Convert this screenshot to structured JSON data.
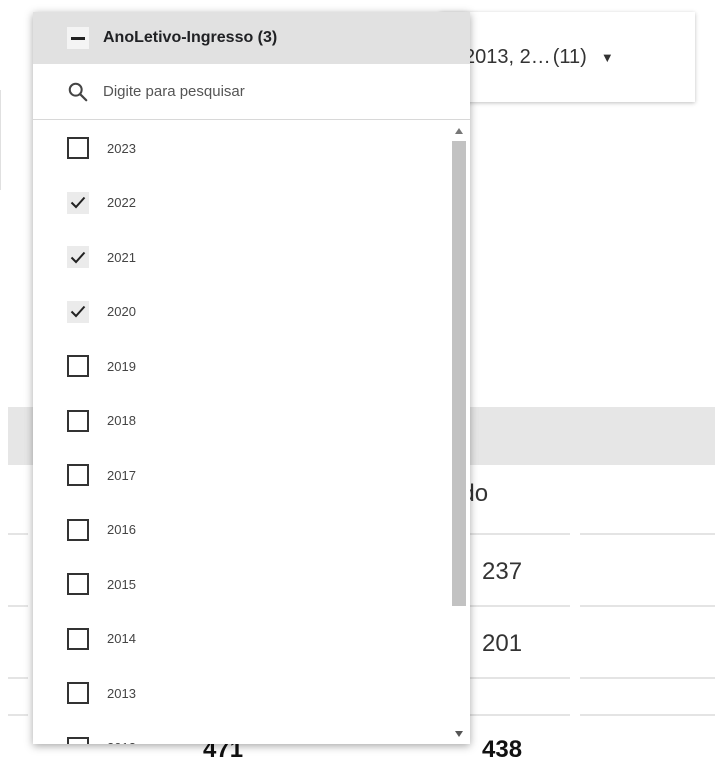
{
  "background": {
    "filter_value": "2013, 2…",
    "filter_count": "(11)",
    "text_fragment": "vo",
    "column_header": "ardo",
    "row_values": [
      "237",
      "201"
    ],
    "totals": [
      "471",
      "438"
    ]
  },
  "dropdown": {
    "title": "AnoLetivo-Ingresso (3)",
    "search_placeholder": "Digite para pesquisar",
    "items": [
      {
        "label": "2023",
        "checked": false
      },
      {
        "label": "2022",
        "checked": true
      },
      {
        "label": "2021",
        "checked": true
      },
      {
        "label": "2020",
        "checked": true
      },
      {
        "label": "2019",
        "checked": false
      },
      {
        "label": "2018",
        "checked": false
      },
      {
        "label": "2017",
        "checked": false
      },
      {
        "label": "2016",
        "checked": false
      },
      {
        "label": "2015",
        "checked": false
      },
      {
        "label": "2014",
        "checked": false
      },
      {
        "label": "2013",
        "checked": false
      },
      {
        "label": "2012",
        "checked": false
      }
    ]
  },
  "icons": {
    "header": "deselect-all-icon",
    "search": "search-icon",
    "check": "check-icon",
    "scroll_up": "scroll-up-icon",
    "scroll_down": "scroll-down-icon"
  }
}
